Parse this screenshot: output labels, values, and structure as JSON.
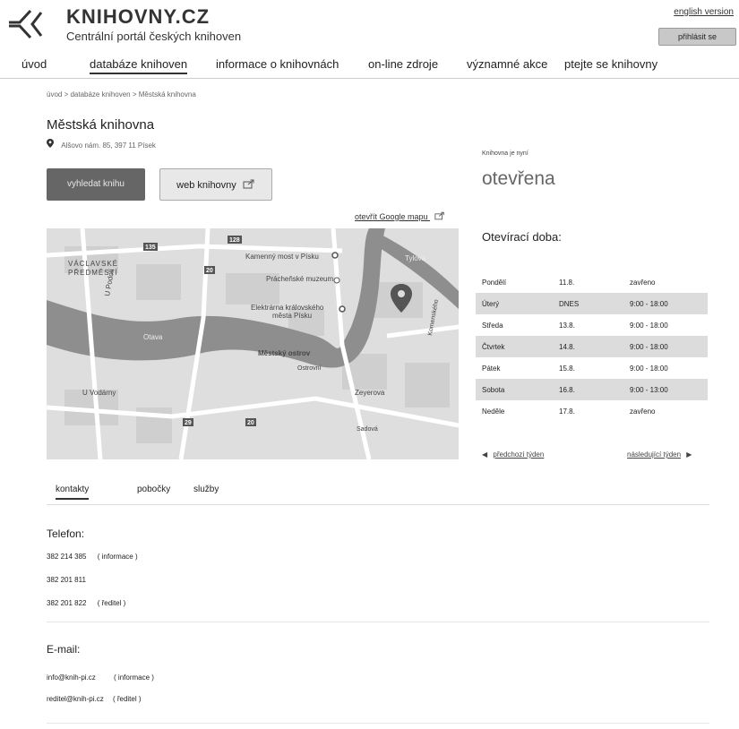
{
  "header": {
    "site_title": "KNIHOVNY.CZ",
    "site_subtitle": "Centrální portál českých knihoven",
    "english_link": "english version",
    "login_button": "přihlásit se"
  },
  "nav": {
    "items": [
      {
        "label": "úvod"
      },
      {
        "label": "databáze knihoven"
      },
      {
        "label": "informace o knihovnách"
      },
      {
        "label": "on-line zdroje"
      },
      {
        "label": "významné akce"
      },
      {
        "label": "ptejte se knihovny"
      }
    ]
  },
  "breadcrumb": "úvod > databáze knihoven > Městská knihovna",
  "library": {
    "name": "Městská knihovna",
    "address": "Alšovo nám. 85, 397 11 Písek",
    "search_button": "vyhledat knihu",
    "web_button": "web knihovny",
    "google_map_link": "otevřít Google mapu"
  },
  "map": {
    "labels": [
      "VÁCLAVSKÉ",
      "PŘEDMĚSTÍ",
      "Kamenný most v Písku",
      "Prácheňské muzeum",
      "Elektrárna královského",
      "města Písku",
      "Městský ostrov",
      "Otava",
      "Tylova",
      "U Podolí",
      "U Vodárny",
      "Zeyerova",
      "Sadová",
      "Ostrovní",
      "Komenského"
    ],
    "road_shields": [
      "135",
      "128",
      "20",
      "20",
      "29"
    ]
  },
  "status": {
    "label": "Knihovna je nyní",
    "value": "otevřena"
  },
  "hours": {
    "title": "Otevírací doba:",
    "rows": [
      {
        "day": "Pondělí",
        "date": "11.8.",
        "time": "zavřeno",
        "shaded": false
      },
      {
        "day": "Úterý",
        "date": "DNES",
        "time": "9:00 - 18:00",
        "shaded": true
      },
      {
        "day": "Středa",
        "date": "13.8.",
        "time": "9:00 - 18:00",
        "shaded": false
      },
      {
        "day": "Čtvrtek",
        "date": "14.8.",
        "time": "9:00 - 18:00",
        "shaded": true
      },
      {
        "day": "Pátek",
        "date": "15.8.",
        "time": "9:00 - 18:00",
        "shaded": false
      },
      {
        "day": "Sobota",
        "date": "16.8.",
        "time": "9:00 - 13:00",
        "shaded": true
      },
      {
        "day": "Neděle",
        "date": "17.8.",
        "time": "zavřeno",
        "shaded": false
      }
    ],
    "prev_week": "předchozí týden",
    "next_week": "následující týden"
  },
  "tabs": [
    {
      "label": "kontakty"
    },
    {
      "label": "pobočky"
    },
    {
      "label": "služby"
    }
  ],
  "contacts": {
    "phone_title": "Telefon:",
    "phones": [
      {
        "number": "382 214 385",
        "note": "( informace )"
      },
      {
        "number": "382 201 811",
        "note": ""
      },
      {
        "number": "382 201 822",
        "note": "( ředitel )"
      }
    ],
    "email_title": "E-mail:",
    "emails": [
      {
        "address": "info@knih-pi.cz",
        "note": "( informace )"
      },
      {
        "address": "reditel@knih-pi.cz",
        "note": "( ředitel )"
      }
    ]
  },
  "colors": {
    "search_button_bg": "#666666",
    "shaded_row": "#dcdcdc",
    "map_bg": "#dedede",
    "river": "#8e8e8e"
  }
}
